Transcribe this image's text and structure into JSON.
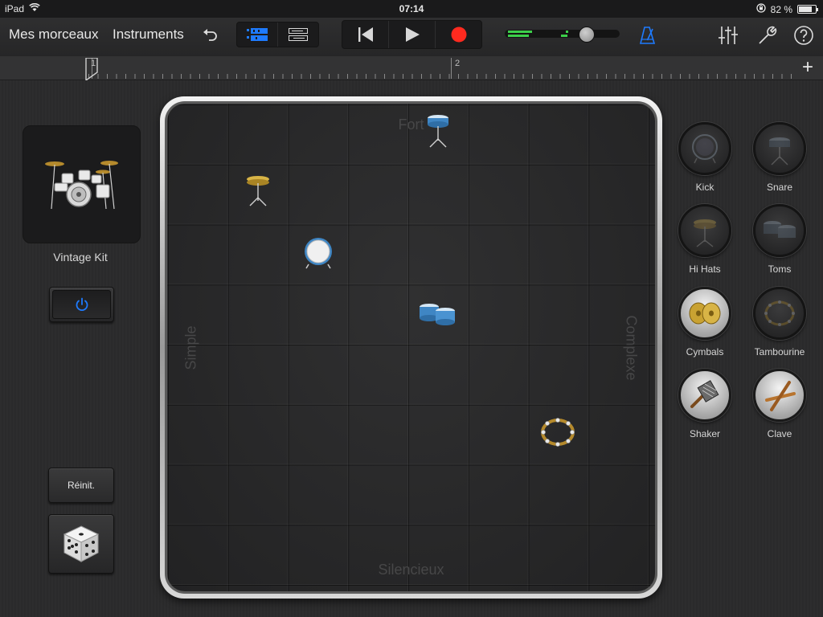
{
  "status": {
    "device": "iPad",
    "time": "07:14",
    "battery": "82 %",
    "battery_level": 0.82
  },
  "toolbar": {
    "my_songs": "Mes morceaux",
    "instruments": "Instruments"
  },
  "ruler": {
    "bar1": "1",
    "bar2": "2"
  },
  "kit": {
    "name": "Vintage Kit"
  },
  "buttons": {
    "reset": "Réinit."
  },
  "pad": {
    "top": "Fort",
    "bottom": "Silencieux",
    "left": "Simple",
    "right": "Complexe"
  },
  "instruments": [
    {
      "label": "Kick",
      "active": false
    },
    {
      "label": "Snare",
      "active": false
    },
    {
      "label": "Hi Hats",
      "active": false
    },
    {
      "label": "Toms",
      "active": false
    },
    {
      "label": "Cymbals",
      "active": true
    },
    {
      "label": "Tambourine",
      "active": false
    },
    {
      "label": "Shaker",
      "active": true
    },
    {
      "label": "Clave",
      "active": true
    }
  ],
  "colors": {
    "accent_blue": "#1e7bff",
    "record_red": "#ff2a1f",
    "meter_green": "#3ccf4a"
  }
}
